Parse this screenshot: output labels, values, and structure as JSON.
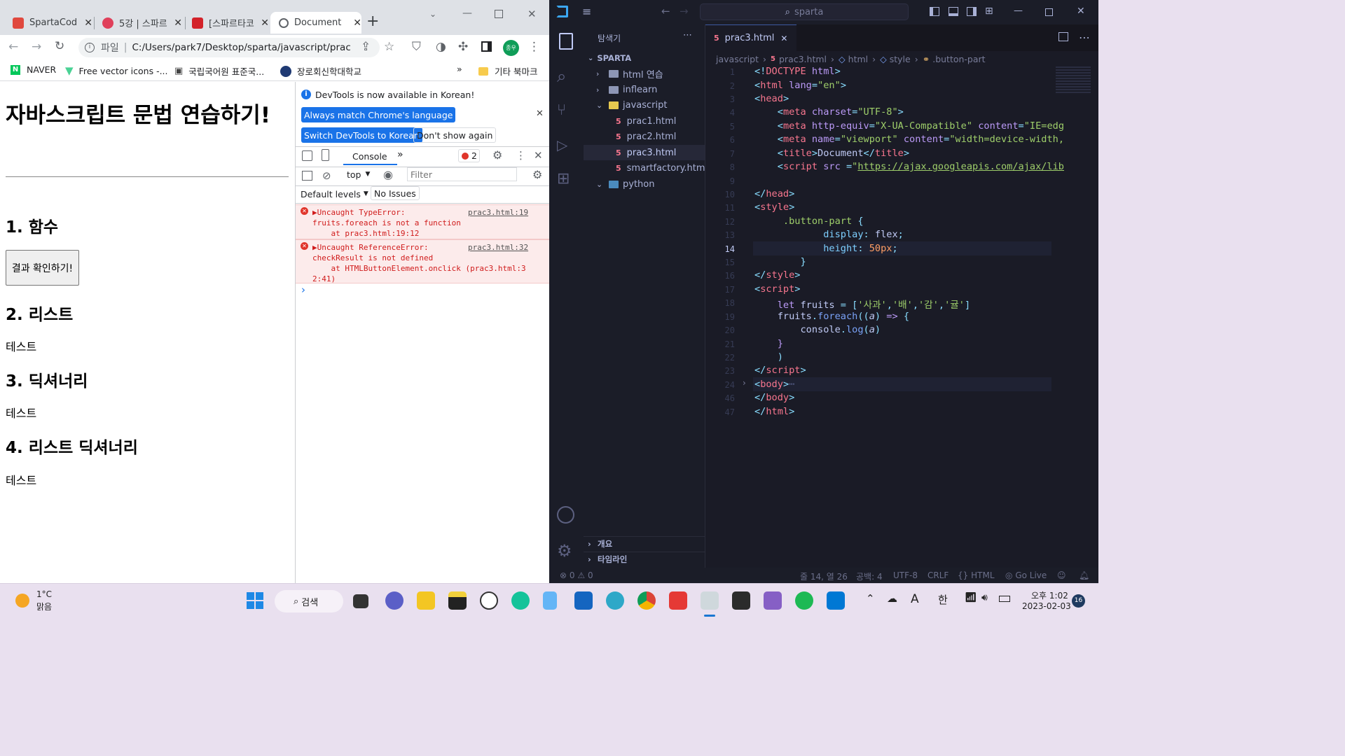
{
  "chrome": {
    "tabs": [
      {
        "label": "SpartaCod",
        "color": "#e0483e"
      },
      {
        "label": "5강 | 스파르",
        "color": "#e0405b"
      },
      {
        "label": "[스파르타코",
        "color": "#d3222a"
      },
      {
        "label": "Document",
        "color": "#5f6368"
      }
    ],
    "new_tab": "+",
    "address_prefix": "파일",
    "address": "C:/Users/park7/Desktop/sparta/javascript/prac...",
    "profile": "종우",
    "bookmarks": [
      "NAVER",
      "Free vector icons -...",
      "국립국어원 표준국...",
      "장로회신학대학교"
    ],
    "bookmarks_more": "»",
    "other_bookmarks": "기타 북마크"
  },
  "page": {
    "title": "자바스크립트 문법 연습하기!",
    "section1": "1. 함수",
    "button": "결과 확인하기!",
    "section2": "2. 리스트",
    "text2": "테스트",
    "section3": "3. 딕셔너리",
    "text3": "테스트",
    "section4": "4. 리스트 딕셔너리",
    "text4": "테스트"
  },
  "devtools": {
    "banner": "DevTools is now available in Korean!",
    "match_btn": "Always match Chrome's language",
    "switch_btn": "Switch DevTools to Korean",
    "dismiss_btn": "Don't show again",
    "console_tab": "Console",
    "more_tabs": "»",
    "error_count": "2",
    "context": "top",
    "filter_placeholder": "Filter",
    "levels": "Default levels",
    "issues": "No Issues",
    "errors": [
      {
        "line1": "▶Uncaught TypeError:",
        "line2": "fruits.foreach is not a function",
        "line3": "    at prac3.html:19:12",
        "link": "prac3.html:19"
      },
      {
        "line1": "▶Uncaught ReferenceError:",
        "line2": "checkResult is not defined",
        "line3": "    at HTMLButtonElement.onclick (prac3.html:3",
        "line4": "2:41)",
        "link": "prac3.html:32"
      }
    ],
    "prompt": "›"
  },
  "vscode": {
    "search": "sparta",
    "explorer_title": "탐색기",
    "workspace": "SPARTA",
    "tree": [
      {
        "label": "html 연습",
        "type": "folder",
        "open": false
      },
      {
        "label": "inflearn",
        "type": "folder",
        "open": false
      },
      {
        "label": "javascript",
        "type": "folder",
        "open": true
      },
      {
        "label": "prac1.html",
        "type": "file"
      },
      {
        "label": "prac2.html",
        "type": "file"
      },
      {
        "label": "prac3.html",
        "type": "file",
        "selected": true
      },
      {
        "label": "smartfactory.html",
        "type": "file"
      },
      {
        "label": "python",
        "type": "folder",
        "open": false
      }
    ],
    "outline": "개요",
    "timeline": "타임라인",
    "tab": "prac3.html",
    "breadcrumb": [
      "javascript",
      "prac3.html",
      "html",
      "style",
      ".button-part"
    ],
    "line_numbers": [
      "1",
      "2",
      "3",
      "4",
      "5",
      "6",
      "7",
      "8",
      "9",
      "10",
      "11",
      "12",
      "13",
      "14",
      "15",
      "16",
      "17",
      "18",
      "19",
      "20",
      "21",
      "22",
      "23",
      "24",
      "46",
      "47"
    ],
    "status": {
      "problems": "0",
      "warnings": "0",
      "position": "줄 14, 열 26",
      "spaces": "공백: 4",
      "encoding": "UTF-8",
      "eol": "CRLF",
      "language": "HTML",
      "golive": "Go Live"
    }
  },
  "taskbar": {
    "weather_temp": "1°C",
    "weather_desc": "맑음",
    "search": "검색",
    "ime1": "A",
    "ime2": "한",
    "time": "오후 1:02",
    "date": "2023-02-03",
    "notifications": "16"
  }
}
